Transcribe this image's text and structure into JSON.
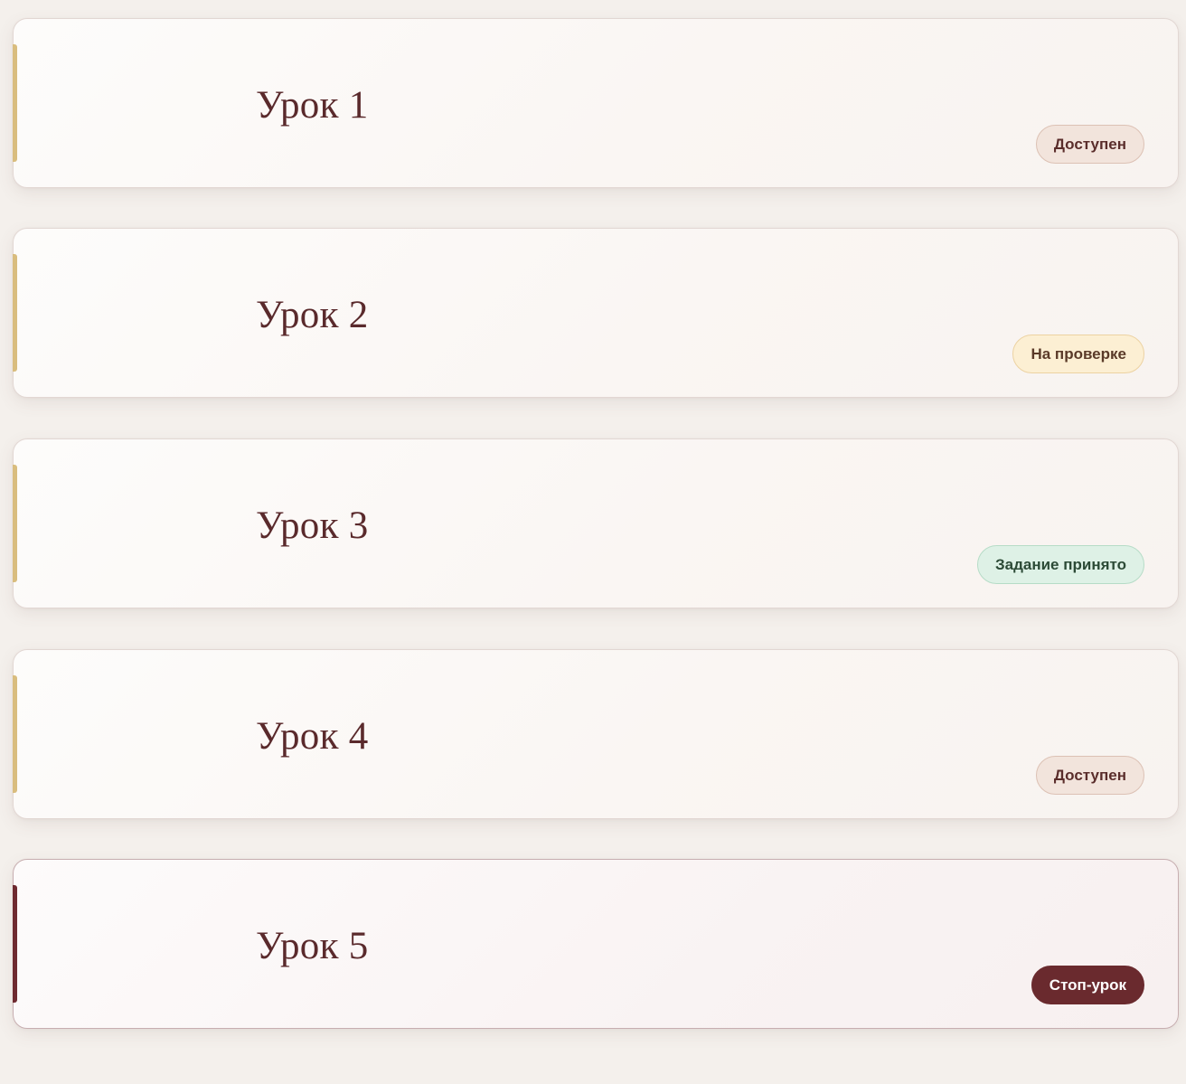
{
  "lessons": [
    {
      "title": "Урок 1",
      "status": "Доступен",
      "status_kind": "available"
    },
    {
      "title": "Урок 2",
      "status": "На проверке",
      "status_kind": "review"
    },
    {
      "title": "Урок 3",
      "status": "Задание принято",
      "status_kind": "accepted"
    },
    {
      "title": "Урок 4",
      "status": "Доступен",
      "status_kind": "available"
    },
    {
      "title": "Урок 5",
      "status": "Стоп-урок",
      "status_kind": "stop"
    }
  ],
  "colors": {
    "page_background": "#f4f0ec",
    "accent_gold": "#d9bd7e",
    "accent_stop": "#6e2a30",
    "title_text": "#5a2a2c"
  }
}
